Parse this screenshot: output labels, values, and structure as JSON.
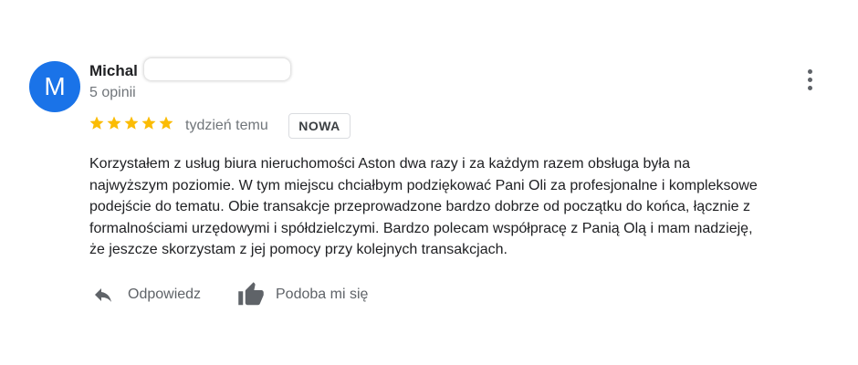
{
  "author": {
    "initial": "M",
    "name": "Michal",
    "review_count": "5 opinii",
    "avatar_color": "#1a73e8"
  },
  "rating": {
    "stars": 5,
    "max_stars": 5,
    "star_color": "#fbbc04"
  },
  "review": {
    "date": "tydzień temu",
    "badge": "NOWA",
    "text_lines": [
      "Korzystałem z usług biura nieruchomości Aston dwa razy i za każdym razem obsługa była na",
      "najwyższym poziomie. W tym miejscu chciałbym podziękować Pani Oli za profesjonalne i kompleksowe",
      "podejście do tematu. Obie transakcje przeprowadzone bardzo dobrze od początku do końca, łącznie z",
      "formalnościami urzędowymi i spółdzielczymi. Bardzo polecam współpracę z Panią Olą i mam nadzieję,",
      "że jeszcze skorzystam z jej pomocy przy kolejnych transakcjach."
    ]
  },
  "actions": {
    "reply_label": "Odpowiedz",
    "reply_icon": "reply-arrow-icon",
    "like_label": "Podoba mi się",
    "like_icon": "thumbs-up-icon",
    "more_icon": "more-vert-icon"
  }
}
